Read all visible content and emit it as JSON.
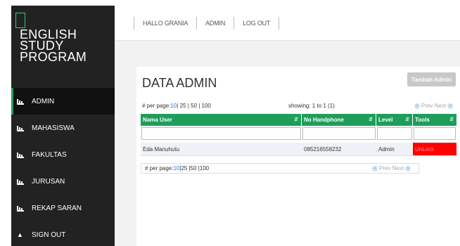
{
  "sidebar": {
    "brand": "ENGLISH\nSTUDY\nPROGRAM",
    "items": [
      {
        "label": "ADMIN",
        "icon": "chart-icon",
        "active": true
      },
      {
        "label": "MAHASISWA",
        "icon": "chart-icon"
      },
      {
        "label": "FAKULTAS",
        "icon": "chart-icon"
      },
      {
        "label": "JURUSAN",
        "icon": "chart-icon"
      },
      {
        "label": "REKAP SARAN",
        "icon": "chart-icon"
      },
      {
        "label": "SIGN OUT",
        "icon": "eject-icon"
      }
    ]
  },
  "header": {
    "greeting": "HALLO GRANIA",
    "role": "ADMIN",
    "logout": "LOG OUT"
  },
  "panel": {
    "title": "DATA ADMIN",
    "add_button": "Tambah Admin",
    "perpage_label": "# per page:",
    "perpage_options_top": [
      "10",
      " | 25 | 50 | 100"
    ],
    "perpage_options_bottom": [
      "10",
      " |25 |50 |100"
    ],
    "showing": "showing: 1 to 1 (1)",
    "prev": "Prev",
    "next": "Next",
    "columns": [
      "Nama User",
      "No Handphone",
      "Level",
      "Tools"
    ],
    "rows": [
      {
        "nama": "Eda Manuhutu",
        "hp": "085216558232",
        "level": "Admin",
        "tools": "UnLock"
      }
    ]
  },
  "colors": {
    "sidebar": "#222222",
    "accent": "#1e9e5a",
    "unlock": "#ff0000"
  }
}
